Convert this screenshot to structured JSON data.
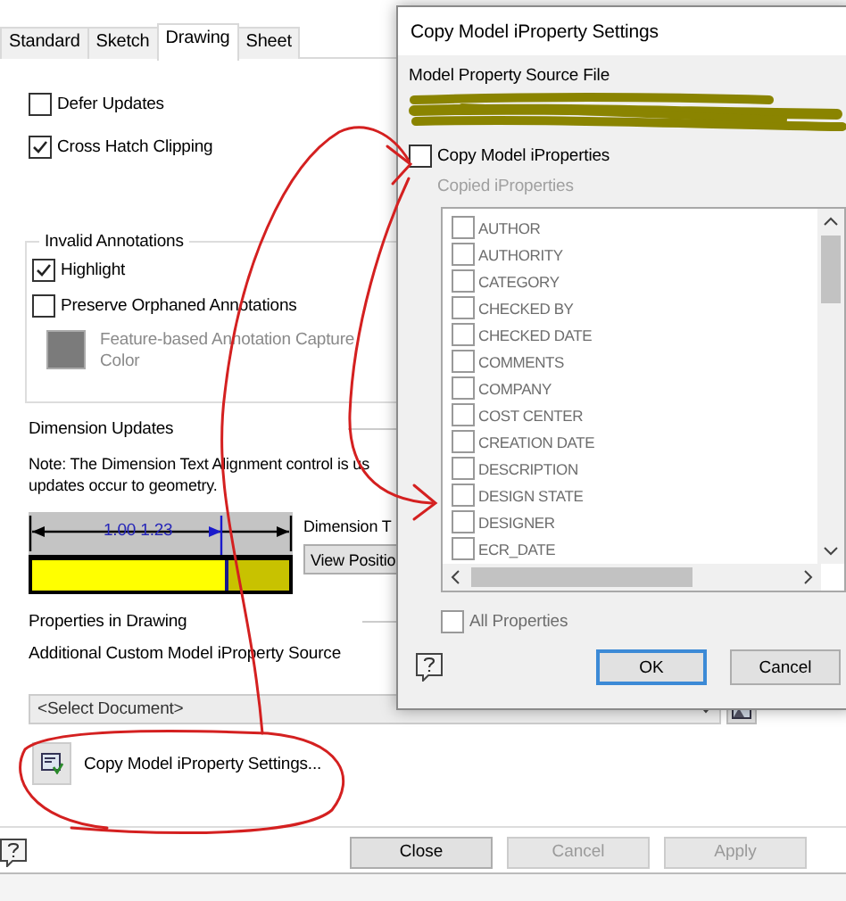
{
  "main": {
    "tabs": [
      {
        "label": "Standard",
        "selected": false
      },
      {
        "label": "Sketch",
        "selected": false
      },
      {
        "label": "Drawing",
        "selected": true
      },
      {
        "label": "Sheet",
        "selected": false
      }
    ],
    "options": [
      {
        "label": "Defer Updates",
        "checked": false
      },
      {
        "label": "Cross Hatch Clipping",
        "checked": true
      }
    ],
    "invalid_annotations": {
      "title": "Invalid Annotations",
      "options": [
        {
          "label": "Highlight",
          "checked": true
        },
        {
          "label": "Preserve Orphaned Annotations",
          "checked": false
        }
      ],
      "color_label": "Feature-based Annotation Capture Color",
      "color_disabled": true
    },
    "dimension_updates": {
      "title": "Dimension Updates",
      "note_lines": [
        "Note: The Dimension Text Alignment control is us",
        "updates occur to geometry."
      ],
      "preview_text": "1.00 1.23",
      "side_label": "Dimension T",
      "side_button": "View Positio"
    },
    "properties": {
      "title": "Properties in Drawing",
      "source_label": "Additional Custom Model iProperty Source",
      "source_value": "<Select Document>",
      "copy_button": "Copy Model iProperty Settings..."
    },
    "footer_buttons": [
      {
        "label": "Close",
        "disabled": false
      },
      {
        "label": "Cancel",
        "disabled": true
      },
      {
        "label": "Apply",
        "disabled": true
      }
    ]
  },
  "dialog": {
    "title": "Copy Model iProperty Settings",
    "source_file_label": "Model Property Source File",
    "copy_option": {
      "label": "Copy Model iProperties",
      "checked": false
    },
    "copied_label": "Copied iProperties",
    "list_disabled": true,
    "properties": [
      {
        "label": "AUTHOR",
        "checked": false
      },
      {
        "label": "AUTHORITY",
        "checked": false
      },
      {
        "label": "CATEGORY",
        "checked": false
      },
      {
        "label": "CHECKED BY",
        "checked": false
      },
      {
        "label": "CHECKED DATE",
        "checked": false
      },
      {
        "label": "COMMENTS",
        "checked": false
      },
      {
        "label": "COMPANY",
        "checked": false
      },
      {
        "label": "COST CENTER",
        "checked": false
      },
      {
        "label": "CREATION DATE",
        "checked": false
      },
      {
        "label": "DESCRIPTION",
        "checked": false
      },
      {
        "label": "DESIGN STATE",
        "checked": false
      },
      {
        "label": "DESIGNER",
        "checked": false
      },
      {
        "label": "ECR_DATE",
        "checked": false
      }
    ],
    "all_properties": {
      "label": "All Properties",
      "checked": false
    },
    "buttons": [
      {
        "label": "OK",
        "default": true
      },
      {
        "label": "Cancel",
        "default": false
      }
    ]
  }
}
